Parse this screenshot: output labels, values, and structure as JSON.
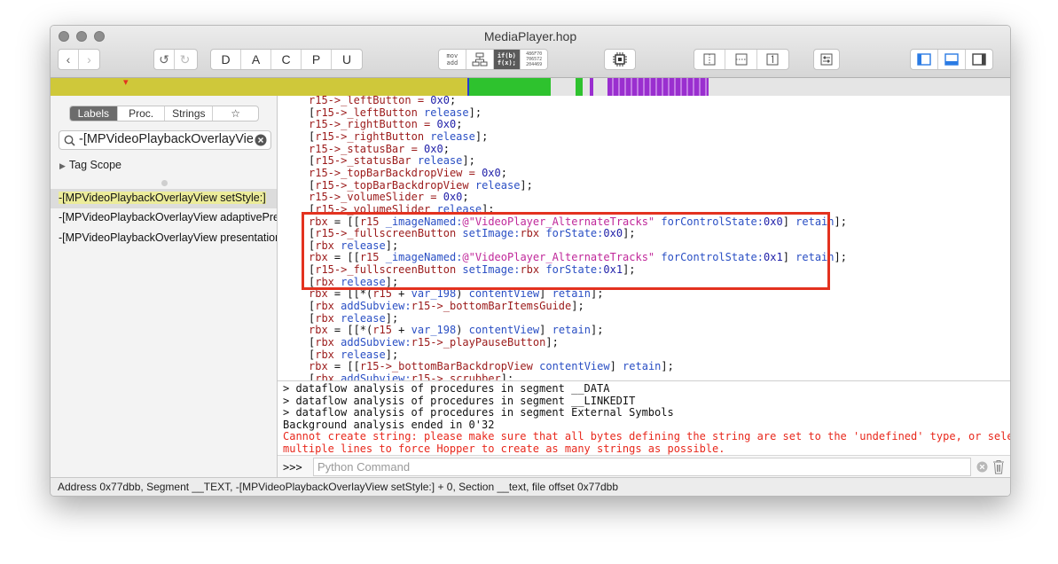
{
  "window": {
    "title": "MediaPlayer.hop"
  },
  "toolbar": {
    "nav": [
      "‹",
      "›"
    ],
    "undo_redo": [
      "↺",
      "↻"
    ],
    "letters": [
      "D",
      "A",
      "C",
      "P",
      "U"
    ],
    "modes": {
      "asm": [
        "mov",
        "add"
      ],
      "pseudo": [
        "if(b)",
        "f(x);"
      ],
      "hex": [
        "486F70",
        "706572",
        "204469"
      ]
    }
  },
  "sidebar": {
    "tabs": [
      "Labels",
      "Proc.",
      "Strings",
      "☆"
    ],
    "selected_tab": "Labels",
    "search_value": "-[MPVideoPlaybackOverlayView",
    "tag_scope": "Tag Scope",
    "results": [
      "-[MPVideoPlaybackOverlayView setStyle:]",
      "-[MPVideoPlaybackOverlayView adaptivePresentationStyleForPresentationController:]",
      "-[MPVideoPlaybackOverlayView presentationController:]"
    ]
  },
  "code": [
    [
      [
        "r15->_leftButton = ",
        "r"
      ],
      [
        "0x0",
        "n"
      ],
      [
        ";",
        ""
      ]
    ],
    [
      [
        "[",
        ""
      ],
      [
        "r15->_leftButton",
        "r"
      ],
      [
        " release",
        "b"
      ],
      [
        "];",
        ""
      ]
    ],
    [
      [
        "r15->_rightButton = ",
        "r"
      ],
      [
        "0x0",
        "n"
      ],
      [
        ";",
        ""
      ]
    ],
    [
      [
        "[",
        ""
      ],
      [
        "r15->_rightButton",
        "r"
      ],
      [
        " release",
        "b"
      ],
      [
        "];",
        ""
      ]
    ],
    [
      [
        "r15->_statusBar = ",
        "r"
      ],
      [
        "0x0",
        "n"
      ],
      [
        ";",
        ""
      ]
    ],
    [
      [
        "[",
        ""
      ],
      [
        "r15->_statusBar",
        "r"
      ],
      [
        " release",
        "b"
      ],
      [
        "];",
        ""
      ]
    ],
    [
      [
        "r15->_topBarBackdropView = ",
        "r"
      ],
      [
        "0x0",
        "n"
      ],
      [
        ";",
        ""
      ]
    ],
    [
      [
        "[",
        ""
      ],
      [
        "r15->_topBarBackdropView",
        "r"
      ],
      [
        " release",
        "b"
      ],
      [
        "];",
        ""
      ]
    ],
    [
      [
        "r15->_volumeSlider = ",
        "r"
      ],
      [
        "0x0",
        "n"
      ],
      [
        ";",
        ""
      ]
    ],
    [
      [
        "[",
        ""
      ],
      [
        "r15->_volumeSlider",
        "r"
      ],
      [
        " release",
        "b"
      ],
      [
        "];",
        ""
      ]
    ],
    [
      [
        "rbx",
        "r"
      ],
      [
        " = [[",
        ""
      ],
      [
        "r15",
        "r"
      ],
      [
        " _imageNamed:",
        "b"
      ],
      [
        "@\"VideoPlayer_AlternateTracks\"",
        "s"
      ],
      [
        " forControlState:",
        "b"
      ],
      [
        "0x0",
        "n"
      ],
      [
        "] ",
        ""
      ],
      [
        "retain",
        "b"
      ],
      [
        "];",
        ""
      ]
    ],
    [
      [
        "[",
        ""
      ],
      [
        "r15->_fullscreenButton",
        "r"
      ],
      [
        " setImage:",
        "b"
      ],
      [
        "rbx",
        "r"
      ],
      [
        " forState:",
        "b"
      ],
      [
        "0x0",
        "n"
      ],
      [
        "];",
        ""
      ]
    ],
    [
      [
        "[",
        ""
      ],
      [
        "rbx",
        "r"
      ],
      [
        " release",
        "b"
      ],
      [
        "];",
        ""
      ]
    ],
    [
      [
        "rbx",
        "r"
      ],
      [
        " = [[",
        ""
      ],
      [
        "r15",
        "r"
      ],
      [
        " _imageNamed:",
        "b"
      ],
      [
        "@\"VideoPlayer_AlternateTracks\"",
        "s"
      ],
      [
        " forControlState:",
        "b"
      ],
      [
        "0x1",
        "n"
      ],
      [
        "] ",
        ""
      ],
      [
        "retain",
        "b"
      ],
      [
        "];",
        ""
      ]
    ],
    [
      [
        "[",
        ""
      ],
      [
        "r15->_fullscreenButton",
        "r"
      ],
      [
        " setImage:",
        "b"
      ],
      [
        "rbx",
        "r"
      ],
      [
        " forState:",
        "b"
      ],
      [
        "0x1",
        "n"
      ],
      [
        "];",
        ""
      ]
    ],
    [
      [
        "[",
        ""
      ],
      [
        "rbx",
        "r"
      ],
      [
        " release",
        "b"
      ],
      [
        "];",
        ""
      ]
    ],
    [
      [
        "rbx",
        "r"
      ],
      [
        " = [[*(",
        ""
      ],
      [
        "r15",
        "r"
      ],
      [
        " + ",
        ""
      ],
      [
        "var_198",
        "b"
      ],
      [
        ") ",
        ""
      ],
      [
        "contentView",
        "b"
      ],
      [
        "] ",
        ""
      ],
      [
        "retain",
        "b"
      ],
      [
        "];",
        ""
      ]
    ],
    [
      [
        "[",
        ""
      ],
      [
        "rbx",
        "r"
      ],
      [
        " addSubview:",
        "b"
      ],
      [
        "r15->_bottomBarItemsGuide",
        "r"
      ],
      [
        "];",
        ""
      ]
    ],
    [
      [
        "[",
        ""
      ],
      [
        "rbx",
        "r"
      ],
      [
        " release",
        "b"
      ],
      [
        "];",
        ""
      ]
    ],
    [
      [
        "rbx",
        "r"
      ],
      [
        " = [[*(",
        ""
      ],
      [
        "r15",
        "r"
      ],
      [
        " + ",
        ""
      ],
      [
        "var_198",
        "b"
      ],
      [
        ") ",
        ""
      ],
      [
        "contentView",
        "b"
      ],
      [
        "] ",
        ""
      ],
      [
        "retain",
        "b"
      ],
      [
        "];",
        ""
      ]
    ],
    [
      [
        "[",
        ""
      ],
      [
        "rbx",
        "r"
      ],
      [
        " addSubview:",
        "b"
      ],
      [
        "r15->_playPauseButton",
        "r"
      ],
      [
        "];",
        ""
      ]
    ],
    [
      [
        "[",
        ""
      ],
      [
        "rbx",
        "r"
      ],
      [
        " release",
        "b"
      ],
      [
        "];",
        ""
      ]
    ],
    [
      [
        "rbx",
        "r"
      ],
      [
        " = [[",
        ""
      ],
      [
        "r15->_bottomBarBackdropView",
        "r"
      ],
      [
        " contentView",
        "b"
      ],
      [
        "] ",
        ""
      ],
      [
        "retain",
        "b"
      ],
      [
        "];",
        ""
      ]
    ],
    [
      [
        "[",
        ""
      ],
      [
        "rbx",
        "r"
      ],
      [
        " addSubview:",
        "b"
      ],
      [
        "r15->_scrubber",
        "r"
      ],
      [
        "];",
        ""
      ]
    ]
  ],
  "console": {
    "lines": [
      "> dataflow analysis of procedures in segment __DATA",
      "> dataflow analysis of procedures in segment __LINKEDIT",
      "> dataflow analysis of procedures in segment External Symbols",
      "Background analysis ended in 0'32"
    ],
    "error_lines": [
      "Cannot create string: please make sure that all bytes defining the string are set to the 'undefined' type, or select",
      "multiple lines to force Hopper to create as many strings as possible."
    ],
    "prompt": ">>>",
    "input_placeholder": "Python Command"
  },
  "statusbar": "Address 0x77dbb, Segment __TEXT, -[MPVideoPlaybackOverlayView setStyle:] + 0, Section __text, file offset 0x77dbb",
  "colors": {
    "highlight_box": "#e3321f",
    "navbar_yellow": "#cfc83a",
    "navbar_green": "#2ec22e",
    "navbar_purple": "#9a2fcf"
  }
}
